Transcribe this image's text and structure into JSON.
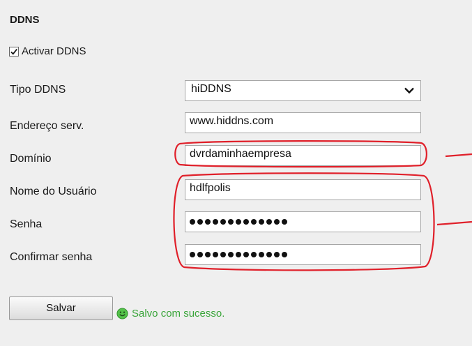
{
  "section": {
    "title": "DDNS"
  },
  "enable_ddns": {
    "label": "Activar DDNS",
    "checked": true
  },
  "form": {
    "tipo_label": "Tipo DDNS",
    "tipo_value": "hiDDNS",
    "endereco_label": "Endereço serv.",
    "endereco_value": "www.hiddns.com",
    "dominio_label": "Domínio",
    "dominio_value": "dvrdaminhaempresa",
    "usuario_label": "Nome do Usuário",
    "usuario_value": "hdlfpolis",
    "senha_label": "Senha",
    "confirmar_label": "Confirmar senha"
  },
  "password_mask_length": 13,
  "actions": {
    "save_label": "Salvar"
  },
  "status": {
    "message": "Salvo com sucesso.",
    "color": "#3aa53a"
  },
  "annotation_color": "#e0202a",
  "icons": {
    "checkbox": "checkmark-icon",
    "dropdown": "chevron-down-icon",
    "status": "smiley-icon"
  }
}
